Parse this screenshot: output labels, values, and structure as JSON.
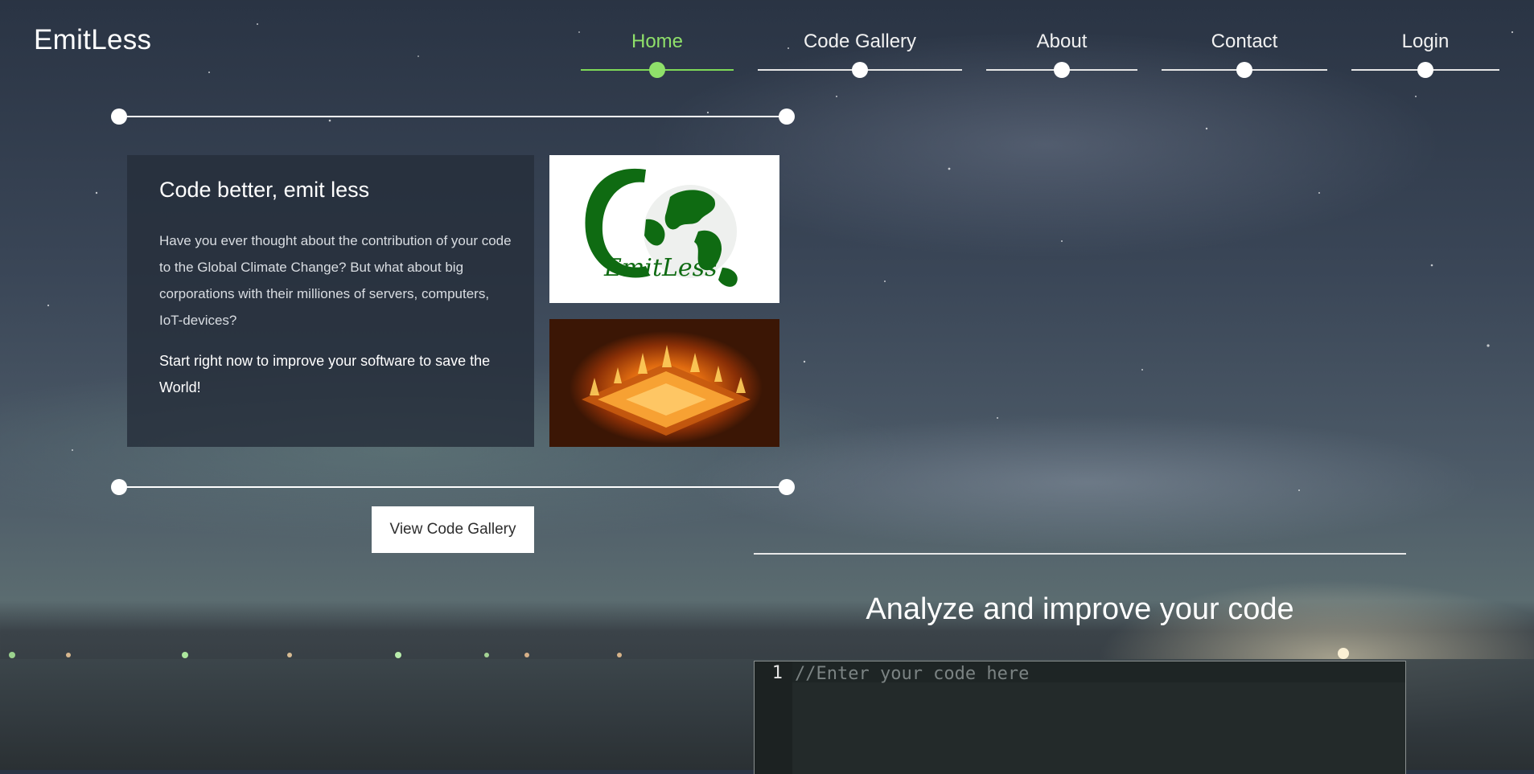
{
  "brand": "EmitLess",
  "nav": {
    "items": [
      {
        "label": "Home",
        "active": true
      },
      {
        "label": "Code Gallery",
        "active": false
      },
      {
        "label": "About",
        "active": false
      },
      {
        "label": "Contact",
        "active": false
      },
      {
        "label": "Login",
        "active": false
      }
    ]
  },
  "hero": {
    "title": "Code better, emit less",
    "intro": "Have you ever thought about the contribution of your code to the Global Climate Change? But what about big corporations with their milliones of servers, computers, IoT-devices?",
    "cta": "Start right now to improve your software to save the World!",
    "logo_text": "EmitLess",
    "button_label": "View Code Gallery"
  },
  "analyze": {
    "title": "Analyze and improve your code",
    "line_number": "1",
    "placeholder": "//Enter your code here"
  },
  "colors": {
    "accent": "#8fe06a",
    "logo_green": "#0f6b12"
  }
}
